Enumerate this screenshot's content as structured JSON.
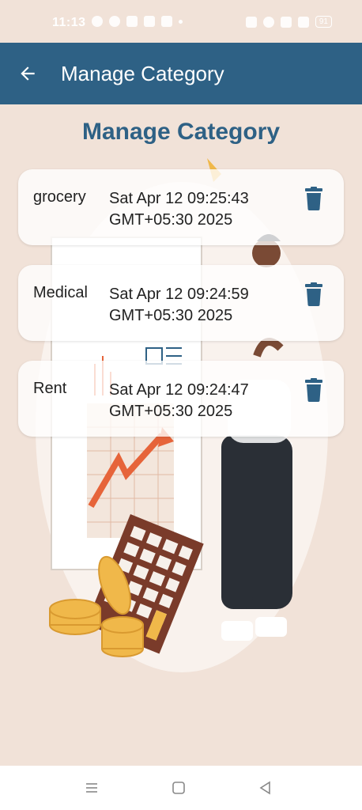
{
  "status_bar": {
    "time": "11:13",
    "battery": "91",
    "left_icons": [
      "chat-bubble-icon",
      "infinity-app-icon",
      "sim-icon",
      "youtube-icon",
      "calendar-icon",
      "dot-icon"
    ],
    "right_icons": [
      "vibrate-icon",
      "wifi-icon",
      "call-wifi-icon",
      "signal-icon",
      "battery-icon"
    ]
  },
  "app_bar": {
    "title": "Manage Category",
    "back_icon": "arrow-left-icon"
  },
  "page": {
    "heading": "Manage Category"
  },
  "categories": [
    {
      "name": "grocery",
      "date": "Sat Apr 12 09:25:43 GMT+05:30 2025"
    },
    {
      "name": "Medical",
      "date": "Sat Apr 12 09:24:59 GMT+05:30 2025"
    },
    {
      "name": "Rent",
      "date": "Sat Apr 12 09:24:47 GMT+05:30 2025"
    }
  ],
  "delete_icon": "trash-icon",
  "nav_bar": {
    "items": [
      "menu-icon",
      "home-square-icon",
      "back-triangle-icon"
    ]
  },
  "colors": {
    "primary": "#2e6185",
    "background": "#f1e2d8",
    "card": "#ffffff",
    "icon": "#2e6185"
  }
}
